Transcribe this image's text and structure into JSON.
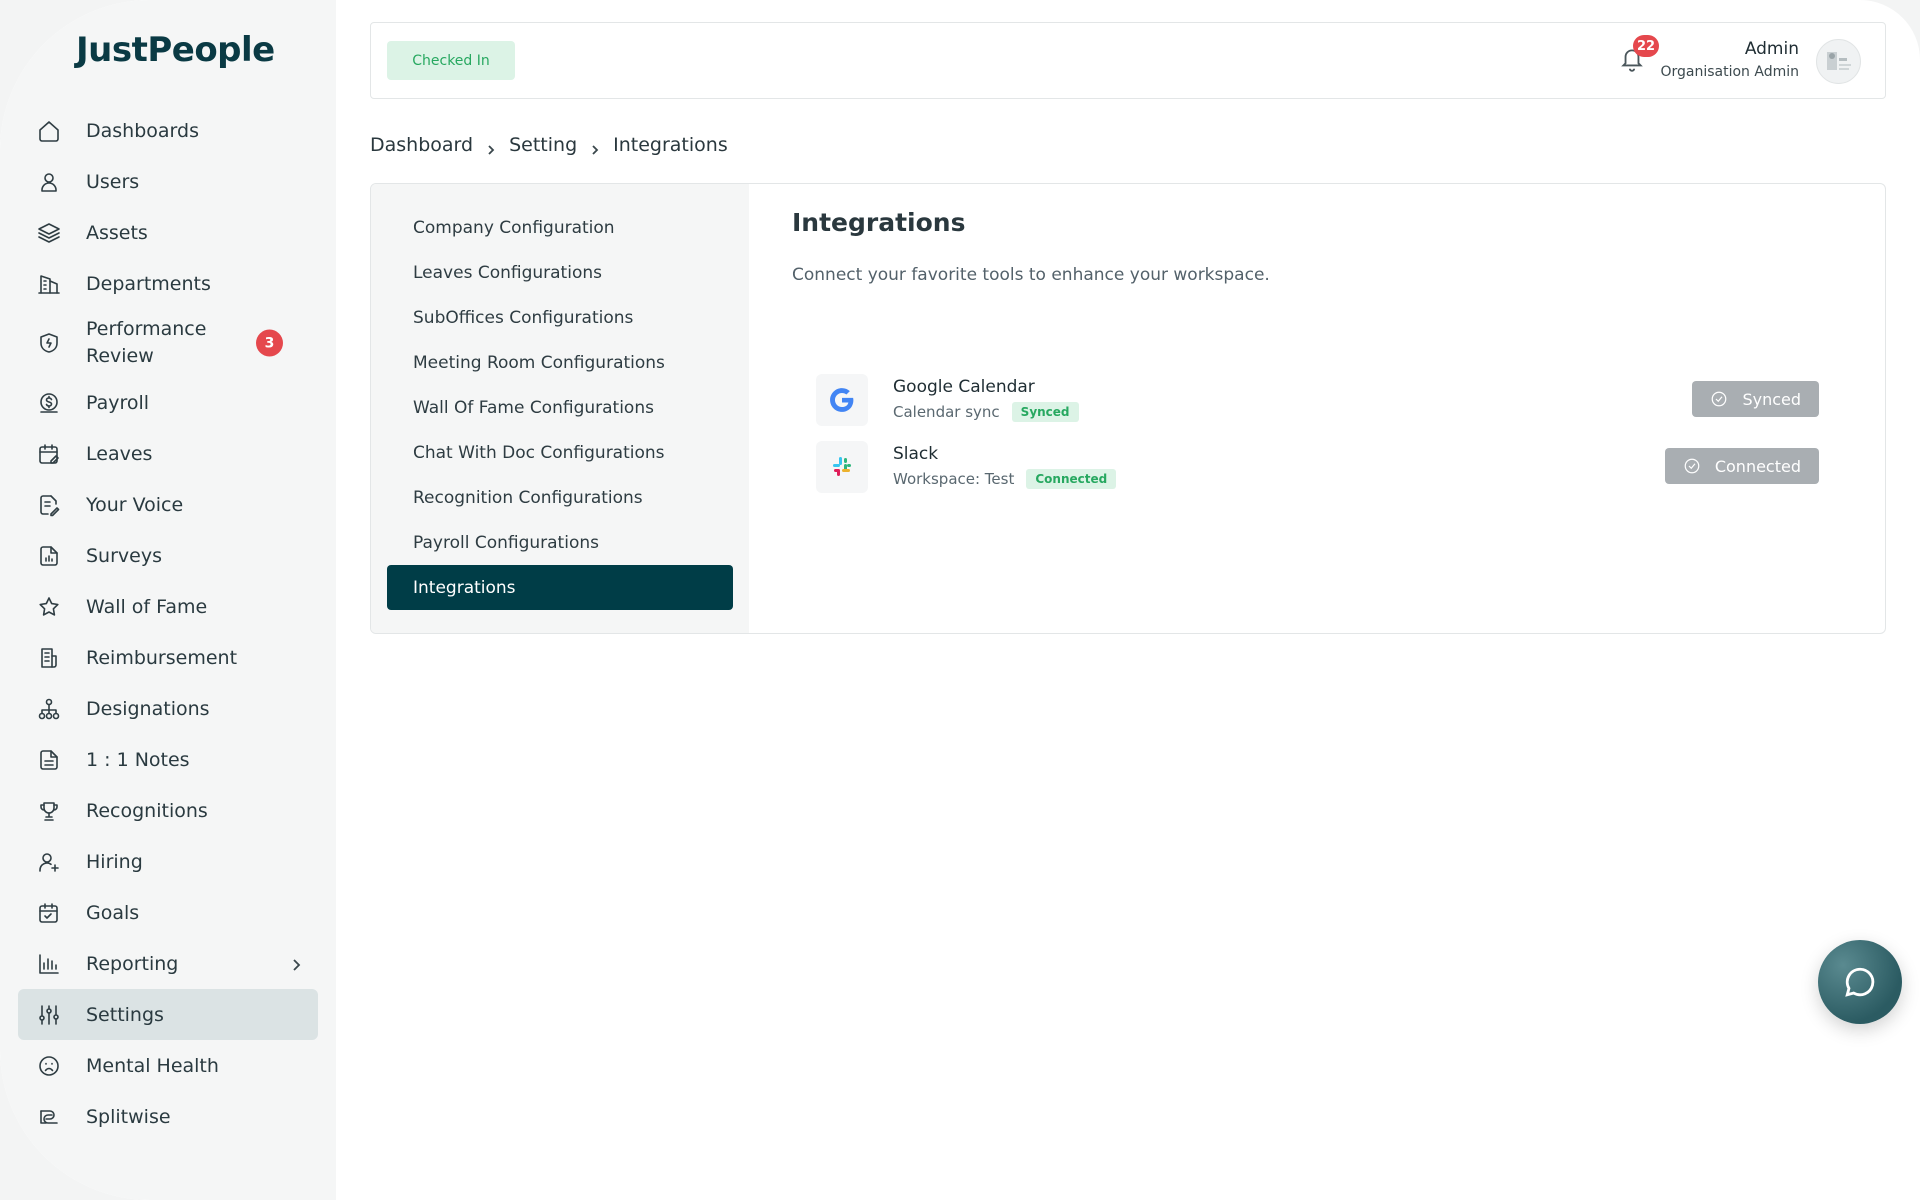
{
  "app": {
    "logo": "JustPeople"
  },
  "sidebar": {
    "items": [
      {
        "label": "Dashboards",
        "icon": "home-icon"
      },
      {
        "label": "Users",
        "icon": "user-icon"
      },
      {
        "label": "Assets",
        "icon": "layers-icon"
      },
      {
        "label": "Departments",
        "icon": "building-icon"
      },
      {
        "label": "Performance Review",
        "icon": "shield-icon",
        "badge": "3"
      },
      {
        "label": "Payroll",
        "icon": "dollar-icon"
      },
      {
        "label": "Leaves",
        "icon": "calendar-edit-icon"
      },
      {
        "label": "Your Voice",
        "icon": "document-edit-icon"
      },
      {
        "label": "Surveys",
        "icon": "document-chart-icon"
      },
      {
        "label": "Wall of Fame",
        "icon": "star-icon"
      },
      {
        "label": "Reimbursement",
        "icon": "receipt-icon"
      },
      {
        "label": "Designations",
        "icon": "hierarchy-icon"
      },
      {
        "label": "1 : 1 Notes",
        "icon": "notes-icon"
      },
      {
        "label": "Recognitions",
        "icon": "trophy-icon"
      },
      {
        "label": "Hiring",
        "icon": "user-plus-icon"
      },
      {
        "label": "Goals",
        "icon": "calendar-check-icon"
      },
      {
        "label": "Reporting",
        "icon": "bar-chart-icon"
      },
      {
        "label": "Settings",
        "icon": "sliders-icon",
        "active": true
      },
      {
        "label": "Mental Health",
        "icon": "sad-face-icon"
      },
      {
        "label": "Splitwise",
        "icon": "split-icon"
      }
    ]
  },
  "topbar": {
    "status": "Checked In",
    "notifications": "22",
    "user_name": "Admin",
    "user_role": "Organisation Admin"
  },
  "breadcrumb": [
    "Dashboard",
    "Setting",
    "Integrations"
  ],
  "settings_menu": [
    "Company Configuration",
    "Leaves Configurations",
    "SubOffices Configurations",
    "Meeting Room Configurations",
    "Wall Of Fame Configurations",
    "Chat With Doc Configurations",
    "Recognition Configurations",
    "Payroll Configurations",
    "Integrations"
  ],
  "content": {
    "title": "Integrations",
    "description": "Connect your favorite tools to enhance your workspace.",
    "integrations": [
      {
        "name": "Google Calendar",
        "detail": "Calendar sync",
        "tag": "Synced",
        "button": "Synced",
        "icon": "google-icon"
      },
      {
        "name": "Slack",
        "detail": "Workspace: Test",
        "tag": "Connected",
        "button": "Connected",
        "icon": "slack-icon"
      }
    ]
  },
  "colors": {
    "brand": "#003d47",
    "success_bg": "#dcf3e6",
    "success_text": "#27a860",
    "badge": "#e5484d"
  }
}
